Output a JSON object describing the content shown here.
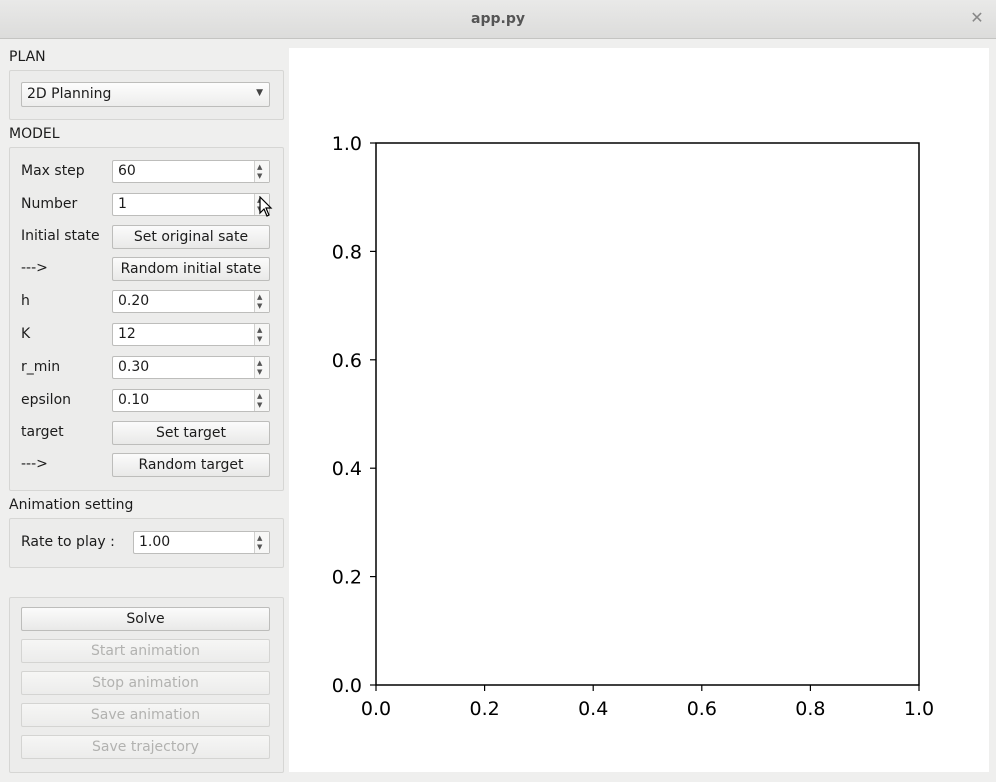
{
  "window": {
    "title": "app.py"
  },
  "plan": {
    "section_label": "PLAN",
    "mode_select": {
      "value": "2D Planning"
    }
  },
  "model": {
    "section_label": "MODEL",
    "max_step": {
      "label": "Max step",
      "value": "60"
    },
    "number": {
      "label": "Number",
      "value": "1"
    },
    "initial_state": {
      "label": "Initial state",
      "button": "Set original sate"
    },
    "initial_random": {
      "label": "--->",
      "button": "Random initial state"
    },
    "h": {
      "label": "h",
      "value": "0.20"
    },
    "K": {
      "label": "K",
      "value": "12"
    },
    "r_min": {
      "label": "r_min",
      "value": "0.30"
    },
    "epsilon": {
      "label": "epsilon",
      "value": "0.10"
    },
    "target": {
      "label": "target",
      "button": "Set target"
    },
    "target_random": {
      "label": "--->",
      "button": "Random target"
    }
  },
  "animation": {
    "section_label": "Animation setting",
    "rate": {
      "label": "Rate to play :",
      "value": "1.00"
    }
  },
  "actions": {
    "solve": "Solve",
    "start_animation": "Start animation",
    "stop_animation": "Stop animation",
    "save_animation": "Save animation",
    "save_trajectory": "Save trajectory"
  },
  "chart_data": {
    "type": "line",
    "series": [],
    "xlim": [
      0.0,
      1.0
    ],
    "ylim": [
      0.0,
      1.0
    ],
    "xticks": [
      "0.0",
      "0.2",
      "0.4",
      "0.6",
      "0.8",
      "1.0"
    ],
    "yticks": [
      "0.0",
      "0.2",
      "0.4",
      "0.6",
      "0.8",
      "1.0"
    ],
    "grid": false
  }
}
